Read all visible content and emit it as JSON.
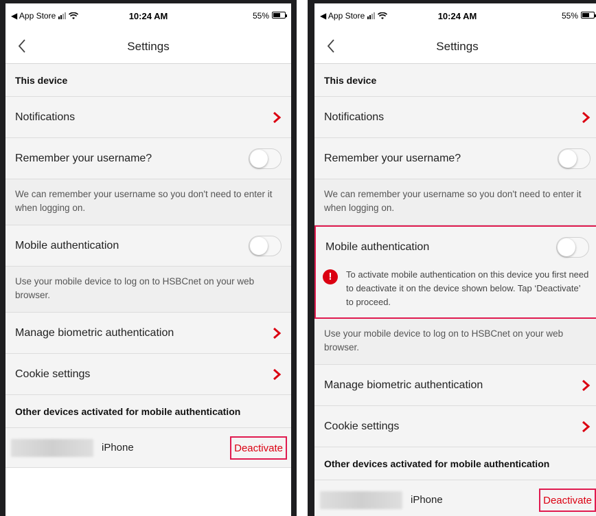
{
  "status_bar": {
    "carrier": "◀ App Store",
    "time": "10:24 AM",
    "battery": "55%"
  },
  "nav": {
    "title": "Settings"
  },
  "sections": {
    "this_device": "This device",
    "other_devices": "Other devices activated for mobile authentication"
  },
  "rows": {
    "notifications": "Notifications",
    "remember_username": "Remember your username?",
    "remember_desc": "We can remember your username so you don't need to enter it when logging on.",
    "mobile_auth": "Mobile authentication",
    "mobile_auth_desc": "Use your mobile device to log on to HSBCnet on your web browser.",
    "manage_biometric": "Manage biometric authentication",
    "cookie_settings": "Cookie settings"
  },
  "warning": {
    "icon": "!",
    "text": "To activate mobile authentication on this device you first need to deactivate it on the device shown below. Tap ‘Deactivate’ to proceed."
  },
  "device": {
    "name": "iPhone",
    "action": "Deactivate"
  },
  "toggles": {
    "remember_username": false,
    "mobile_auth": false
  },
  "colors": {
    "accent": "#db0011",
    "highlight": "#e01a4f"
  },
  "icons": [
    "back-chevron-icon",
    "chevron-right-icon",
    "warning-icon",
    "signal-icon",
    "wifi-icon",
    "battery-icon"
  ]
}
